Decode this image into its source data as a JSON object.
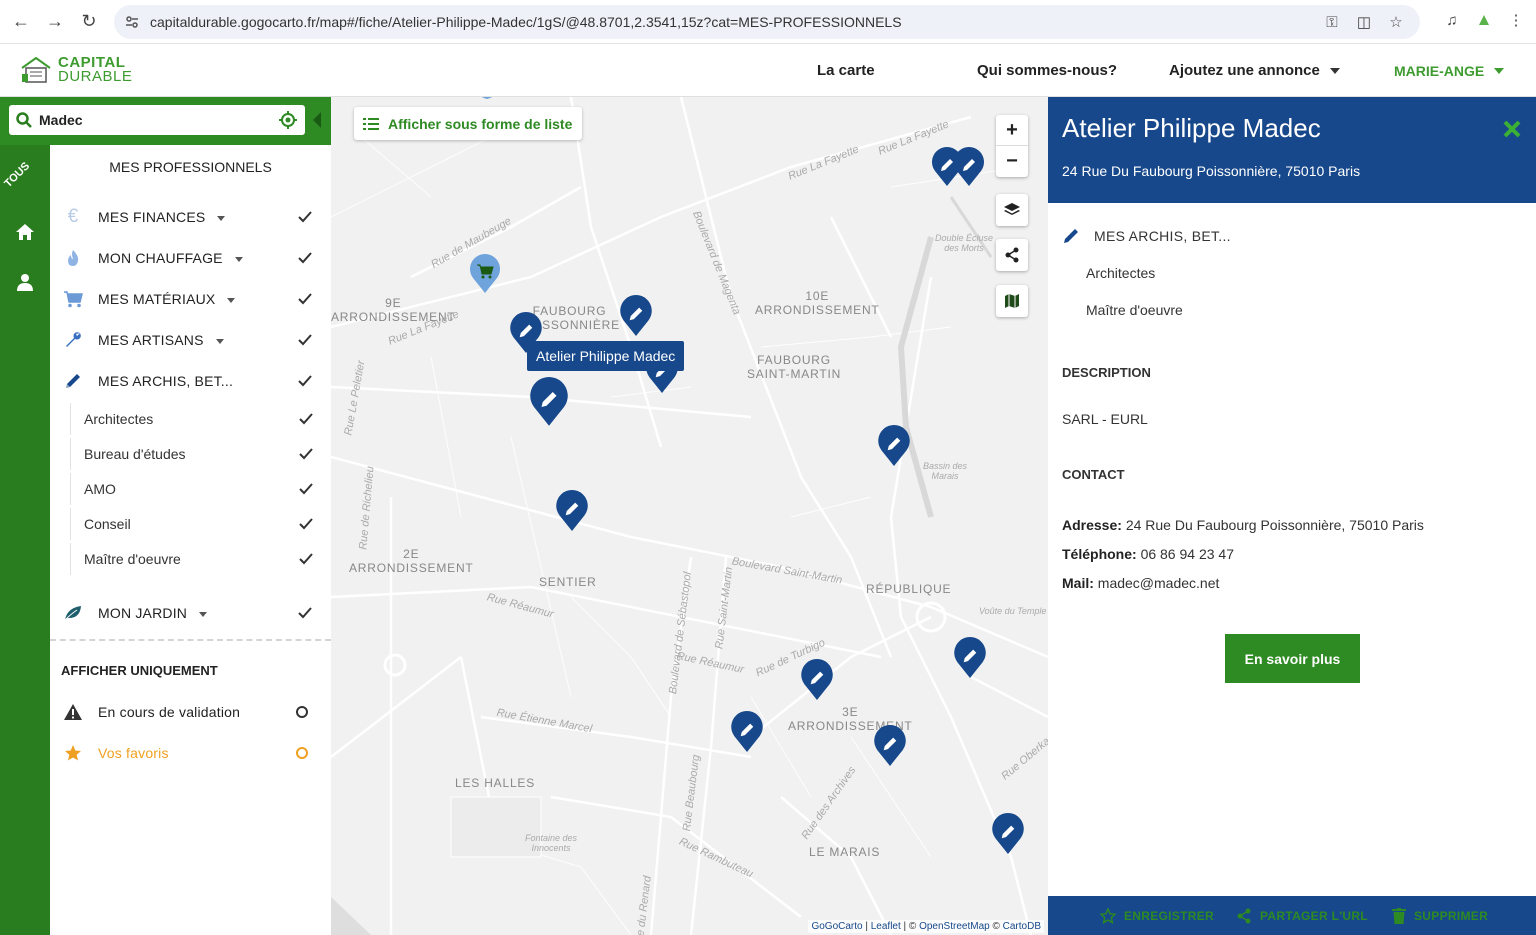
{
  "browser": {
    "url": "capitaldurable.gogocarto.fr/map#/fiche/Atelier-Philippe-Madec/1gS/@48.8701,2.3541,15z?cat=MES-PROFESSIONNELS",
    "icons": [
      "back-icon",
      "forward-icon",
      "reload-icon",
      "site-info-icon",
      "key-icon",
      "install-icon",
      "star-icon",
      "media-icon",
      "extension-icon",
      "menu-icon"
    ]
  },
  "header": {
    "logo_line1": "CAPITAL",
    "logo_line2": "DURABLE",
    "nav": [
      "La carte",
      "Qui sommes-nous?",
      "Ajoutez une annonce"
    ],
    "user": "MARIE-ANGE"
  },
  "search": {
    "value": "Madec"
  },
  "strip": {
    "tous": "TOUS"
  },
  "sidebar": {
    "title": "MES PROFESSIONNELS",
    "categories": [
      {
        "label": "MES FINANCES",
        "icon": "euro-icon"
      },
      {
        "label": "MON CHAUFFAGE",
        "icon": "flame-icon"
      },
      {
        "label": "MES MATÉRIAUX",
        "icon": "cart-icon"
      },
      {
        "label": "MES ARTISANS",
        "icon": "wrench-icon"
      },
      {
        "label": "MES ARCHIS, BET...",
        "icon": "pencil-icon"
      }
    ],
    "subcategories": [
      "Architectes",
      "Bureau d'études",
      "AMO",
      "Conseil",
      "Maître d'oeuvre"
    ],
    "last_category": {
      "label": "MON JARDIN",
      "icon": "leaf-icon"
    },
    "filter_title": "AFFICHER UNIQUEMENT",
    "filters": [
      {
        "label": "En cours de validation",
        "icon": "warning-icon"
      },
      {
        "label": "Vos favoris",
        "icon": "star-icon"
      }
    ]
  },
  "map": {
    "list_button": "Afficher sous forme de liste",
    "tooltip": "Atelier Philippe Madec",
    "labels": {
      "arr9": [
        "9E",
        "ARRONDISSEMENT"
      ],
      "faubourg_poiss": [
        "FAUBOURG",
        "POISSONNIÈRE"
      ],
      "arr10": [
        "10E",
        "ARRONDISSEMENT"
      ],
      "faubourg_sm": [
        "FAUBOURG",
        "SAINT-MARTIN"
      ],
      "arr2": [
        "2E",
        "ARRONDISSEMENT"
      ],
      "sentier": "SENTIER",
      "republique": "RÉPUBLIQUE",
      "arr3": [
        "3E",
        "ARRONDISSEMENT"
      ],
      "halles": "LES HALLES",
      "marais": "LE MARAIS"
    },
    "streets": [
      "Rue La Fayette",
      "Rue La Fayette",
      "Rue de Maubeuge",
      "Boulevard de Magenta",
      "Rue La Fayette",
      "Boulevard Saint-Martin",
      "Rue Réaumur",
      "Rue Réaumur",
      "Boulevard de Sébastopol",
      "Rue Saint-Martin",
      "Rue de Turbigo",
      "Rue Étienne Marcel",
      "Rue Beaubourg",
      "Rue Rambuteau",
      "Rue des Archives",
      "Rue Oberkampf",
      "Rue de Richelieu",
      "Rue Le Peletier",
      "Double Écluse des Morts",
      "Bassin des Marais",
      "Voûte du Temple",
      "Fontaine des Innocents",
      "Rue du Renard"
    ],
    "attribution": {
      "gogo": "GoGoCarto",
      "leaflet": "Leaflet",
      "osm": "OpenStreetMap",
      "carto": "CartoDB",
      "sep1": " | ",
      "sep2": " | © ",
      "sep3": " © "
    }
  },
  "panel": {
    "title": "Atelier Philippe Madec",
    "address": "24 Rue Du Faubourg Poissonnière, 75010 Paris",
    "category": "MES ARCHIS, BET...",
    "subcategories": [
      "Architectes",
      "Maître d'oeuvre"
    ],
    "description_title": "DESCRIPTION",
    "description": "SARL - EURL",
    "contact_title": "CONTACT",
    "contact": {
      "address_label": "Adresse:",
      "address": "24 Rue Du Faubourg Poissonnière, 75010 Paris",
      "phone_label": "Téléphone:",
      "phone": "06 86 94 23 47",
      "mail_label": "Mail:",
      "mail": "madec@madec.net"
    },
    "more_button": "En savoir plus",
    "footer": [
      "ENREGISTRER",
      "PARTAGER L'URL",
      "SUPPRIMER"
    ]
  },
  "colors": {
    "green": "#2e8a22",
    "dark_green": "#2a7d1e",
    "blue": "#17488b",
    "favorite": "#f0a020"
  }
}
